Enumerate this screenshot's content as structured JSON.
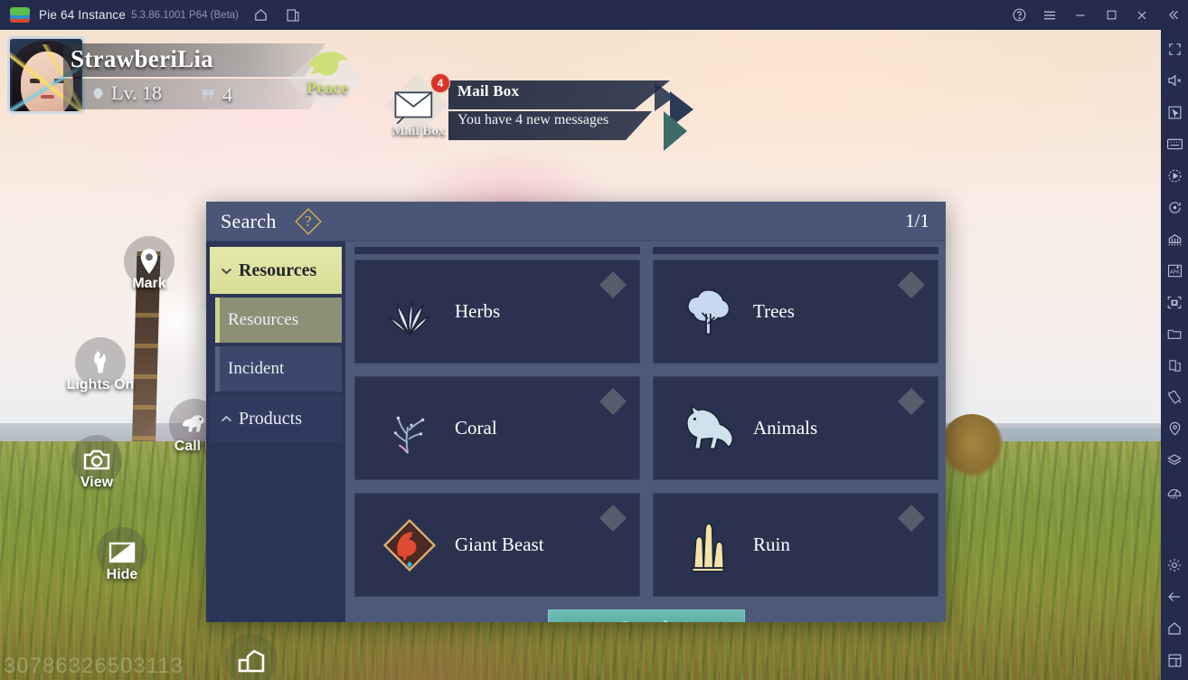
{
  "titlebar": {
    "app_title": "Pie 64 Instance",
    "version": "5.3.86.1001 P64 (Beta)",
    "icons": [
      "home-icon",
      "multi-instance-icon"
    ],
    "right_icons": [
      "help-icon",
      "menu-icon",
      "minimize-icon",
      "maximize-icon",
      "close-icon",
      "collapse-icon"
    ]
  },
  "player": {
    "name": "StrawberiLia",
    "level": "Lv. 18",
    "guild_count": "4",
    "status": "Peace"
  },
  "mailbox": {
    "label": "Mail Box",
    "title": "Mail Box",
    "message": "You have 4 new messages",
    "badge": "4"
  },
  "hud": [
    {
      "id": "mark",
      "label": "Mark",
      "icon": "map-pin-icon"
    },
    {
      "id": "lights",
      "label": "Lights On",
      "icon": "torch-icon"
    },
    {
      "id": "view",
      "label": "View",
      "icon": "camera-icon"
    },
    {
      "id": "call",
      "label": "Call P",
      "icon": "mount-icon"
    },
    {
      "id": "hide",
      "label": "Hide",
      "icon": "hide-panel-icon"
    },
    {
      "id": "home",
      "label": "",
      "icon": "house-icon"
    }
  ],
  "dialog": {
    "title": "Search",
    "help_glyph": "?",
    "page_indicator": "1/1",
    "sidebar": {
      "groups": [
        {
          "label": "Resources",
          "expanded": true,
          "chevron": "chevron-down-icon",
          "items": [
            {
              "label": "Resources",
              "selected": true
            },
            {
              "label": "Incident",
              "selected": false
            }
          ]
        },
        {
          "label": "Products",
          "expanded": false,
          "chevron": "chevron-up-icon",
          "items": []
        }
      ]
    },
    "cards": [
      {
        "label": "Herbs",
        "icon": "herbs-icon",
        "checked": false
      },
      {
        "label": "Trees",
        "icon": "tree-icon",
        "checked": false
      },
      {
        "label": "Coral",
        "icon": "coral-icon",
        "checked": false
      },
      {
        "label": "Animals",
        "icon": "animal-icon",
        "checked": false
      },
      {
        "label": "Giant Beast",
        "icon": "giant-beast-icon",
        "checked": false
      },
      {
        "label": "Ruin",
        "icon": "ruin-icon",
        "checked": false
      }
    ],
    "search_button": "Search"
  },
  "rail": {
    "top_icons": [
      "fullscreen-icon",
      "mute-icon",
      "pointer-icon",
      "keyboard-icon",
      "macro-icon",
      "rotate-icon",
      "multi-instance-icon",
      "apk-install-icon",
      "screenshot-icon",
      "folder-icon",
      "flip-icon",
      "tilt-icon",
      "location-icon",
      "layers-icon",
      "meter-icon"
    ],
    "bottom_icons": [
      "gear-icon",
      "back-arrow-icon",
      "home-icon",
      "recents-icon"
    ]
  },
  "watermark": "30786326503113",
  "colors": {
    "titlebar_bg": "#242b4d",
    "dialog_header": "#4a5577",
    "dialog_body": "#4e5878",
    "dialog_sidebar": "#2c3557",
    "card_bg": "#2b3250",
    "accent_yellow": "#dfe49f",
    "accent_teal": "#5cb0a7",
    "badge_red": "#d8342a",
    "peace_green": "#c8dc6e"
  }
}
